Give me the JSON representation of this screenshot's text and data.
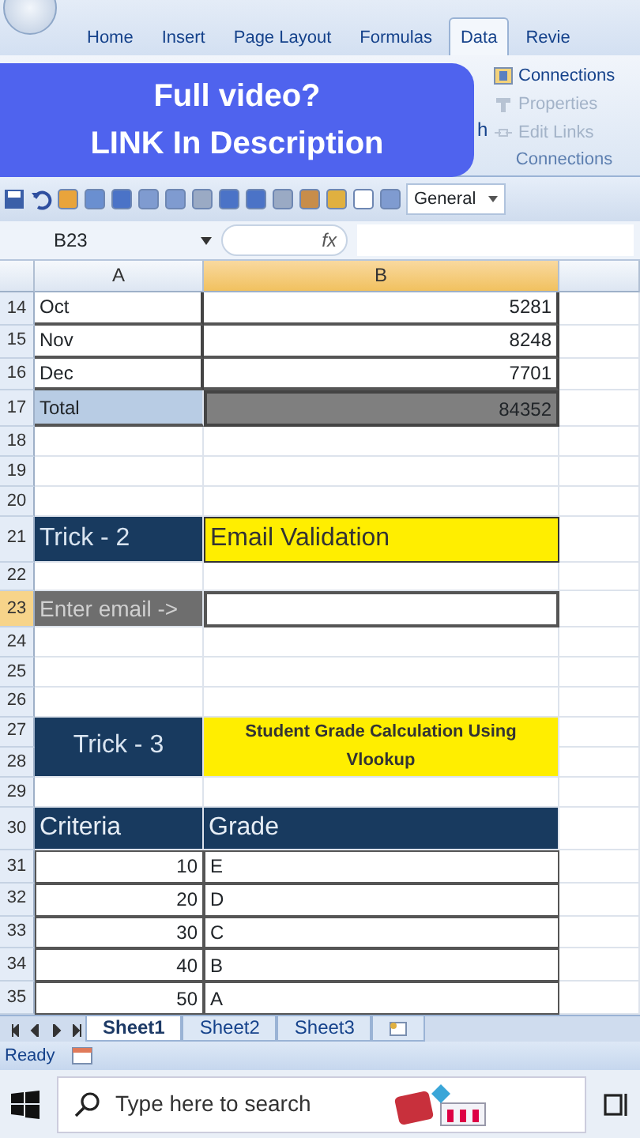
{
  "ribbon": {
    "tabs": [
      {
        "label": "Home",
        "selected": false
      },
      {
        "label": "Insert",
        "selected": false
      },
      {
        "label": "Page Layout",
        "selected": false
      },
      {
        "label": "Formulas",
        "selected": false
      },
      {
        "label": "Data",
        "selected": true
      },
      {
        "label": "Revie",
        "selected": false
      }
    ],
    "fragment": "h",
    "group": {
      "title": "Connections",
      "items": [
        {
          "label": "Connections",
          "disabled": false
        },
        {
          "label": "Properties",
          "disabled": true
        },
        {
          "label": "Edit Links",
          "disabled": true
        }
      ]
    }
  },
  "banner": {
    "lines": [
      "Full video?",
      "LINK In Description"
    ]
  },
  "toolbar": {
    "number_format": "General"
  },
  "formula_bar": {
    "name_box": "B23",
    "fx": "fx"
  },
  "columns": [
    {
      "label": "A"
    },
    {
      "label": "B"
    }
  ],
  "rows": [
    {
      "number": "14",
      "cells": [
        {
          "kind": "text",
          "text": "Oct"
        },
        {
          "kind": "number",
          "text": "5281"
        }
      ]
    },
    {
      "number": "15",
      "cells": [
        {
          "kind": "text",
          "text": "Nov"
        },
        {
          "kind": "number",
          "text": "8248"
        }
      ]
    },
    {
      "number": "16",
      "cells": [
        {
          "kind": "text",
          "text": "Dec"
        },
        {
          "kind": "number",
          "text": "7701"
        }
      ]
    },
    {
      "number": "17",
      "cells": [
        {
          "kind": "total-label",
          "text": "Total"
        },
        {
          "kind": "total-value",
          "text": "84352"
        }
      ]
    },
    {
      "number": "18",
      "cells": []
    },
    {
      "number": "19",
      "cells": []
    },
    {
      "number": "20",
      "cells": []
    },
    {
      "number": "21",
      "cells": [
        {
          "kind": "navy-title",
          "text": "Trick - 2"
        },
        {
          "kind": "yellow-title",
          "text": "Email Validation"
        }
      ]
    },
    {
      "number": "22",
      "cells": []
    },
    {
      "number": "23",
      "cells": [
        {
          "kind": "gray-label",
          "text": "Enter email ->"
        },
        {
          "kind": "entry"
        }
      ]
    },
    {
      "number": "24",
      "cells": []
    },
    {
      "number": "25",
      "cells": []
    },
    {
      "number": "26",
      "cells": []
    },
    {
      "number": "27",
      "cells": [
        {
          "kind": "navy-title",
          "text": "Trick - 3",
          "merged_down": true
        },
        {
          "kind": "yellow-note",
          "text": "Student Grade Calculation Using Vlookup",
          "merged_down": true
        }
      ]
    },
    {
      "number": "28",
      "cells": []
    },
    {
      "number": "29",
      "cells": []
    },
    {
      "number": "30",
      "cells": [
        {
          "kind": "table-header",
          "text": "Criteria"
        },
        {
          "kind": "table-header",
          "text": "Grade"
        }
      ]
    },
    {
      "number": "31",
      "cells": [
        {
          "kind": "table-number",
          "text": "10"
        },
        {
          "kind": "table-text",
          "text": "E"
        }
      ]
    },
    {
      "number": "32",
      "cells": [
        {
          "kind": "table-number",
          "text": "20"
        },
        {
          "kind": "table-text",
          "text": "D"
        }
      ]
    },
    {
      "number": "33",
      "cells": [
        {
          "kind": "table-number",
          "text": "30"
        },
        {
          "kind": "table-text",
          "text": "C"
        }
      ]
    },
    {
      "number": "34",
      "cells": [
        {
          "kind": "table-number",
          "text": "40"
        },
        {
          "kind": "table-text",
          "text": "B"
        }
      ]
    },
    {
      "number": "35",
      "cells": [
        {
          "kind": "table-number",
          "text": "50"
        },
        {
          "kind": "table-text",
          "text": "A"
        }
      ]
    }
  ],
  "sheet_tabs": [
    {
      "label": "Sheet1",
      "selected": true
    },
    {
      "label": "Sheet2",
      "selected": false
    },
    {
      "label": "Sheet3",
      "selected": false
    }
  ],
  "status_bar": {
    "text": "Ready"
  },
  "taskbar": {
    "search": {
      "placeholder": "Type here to search"
    }
  }
}
